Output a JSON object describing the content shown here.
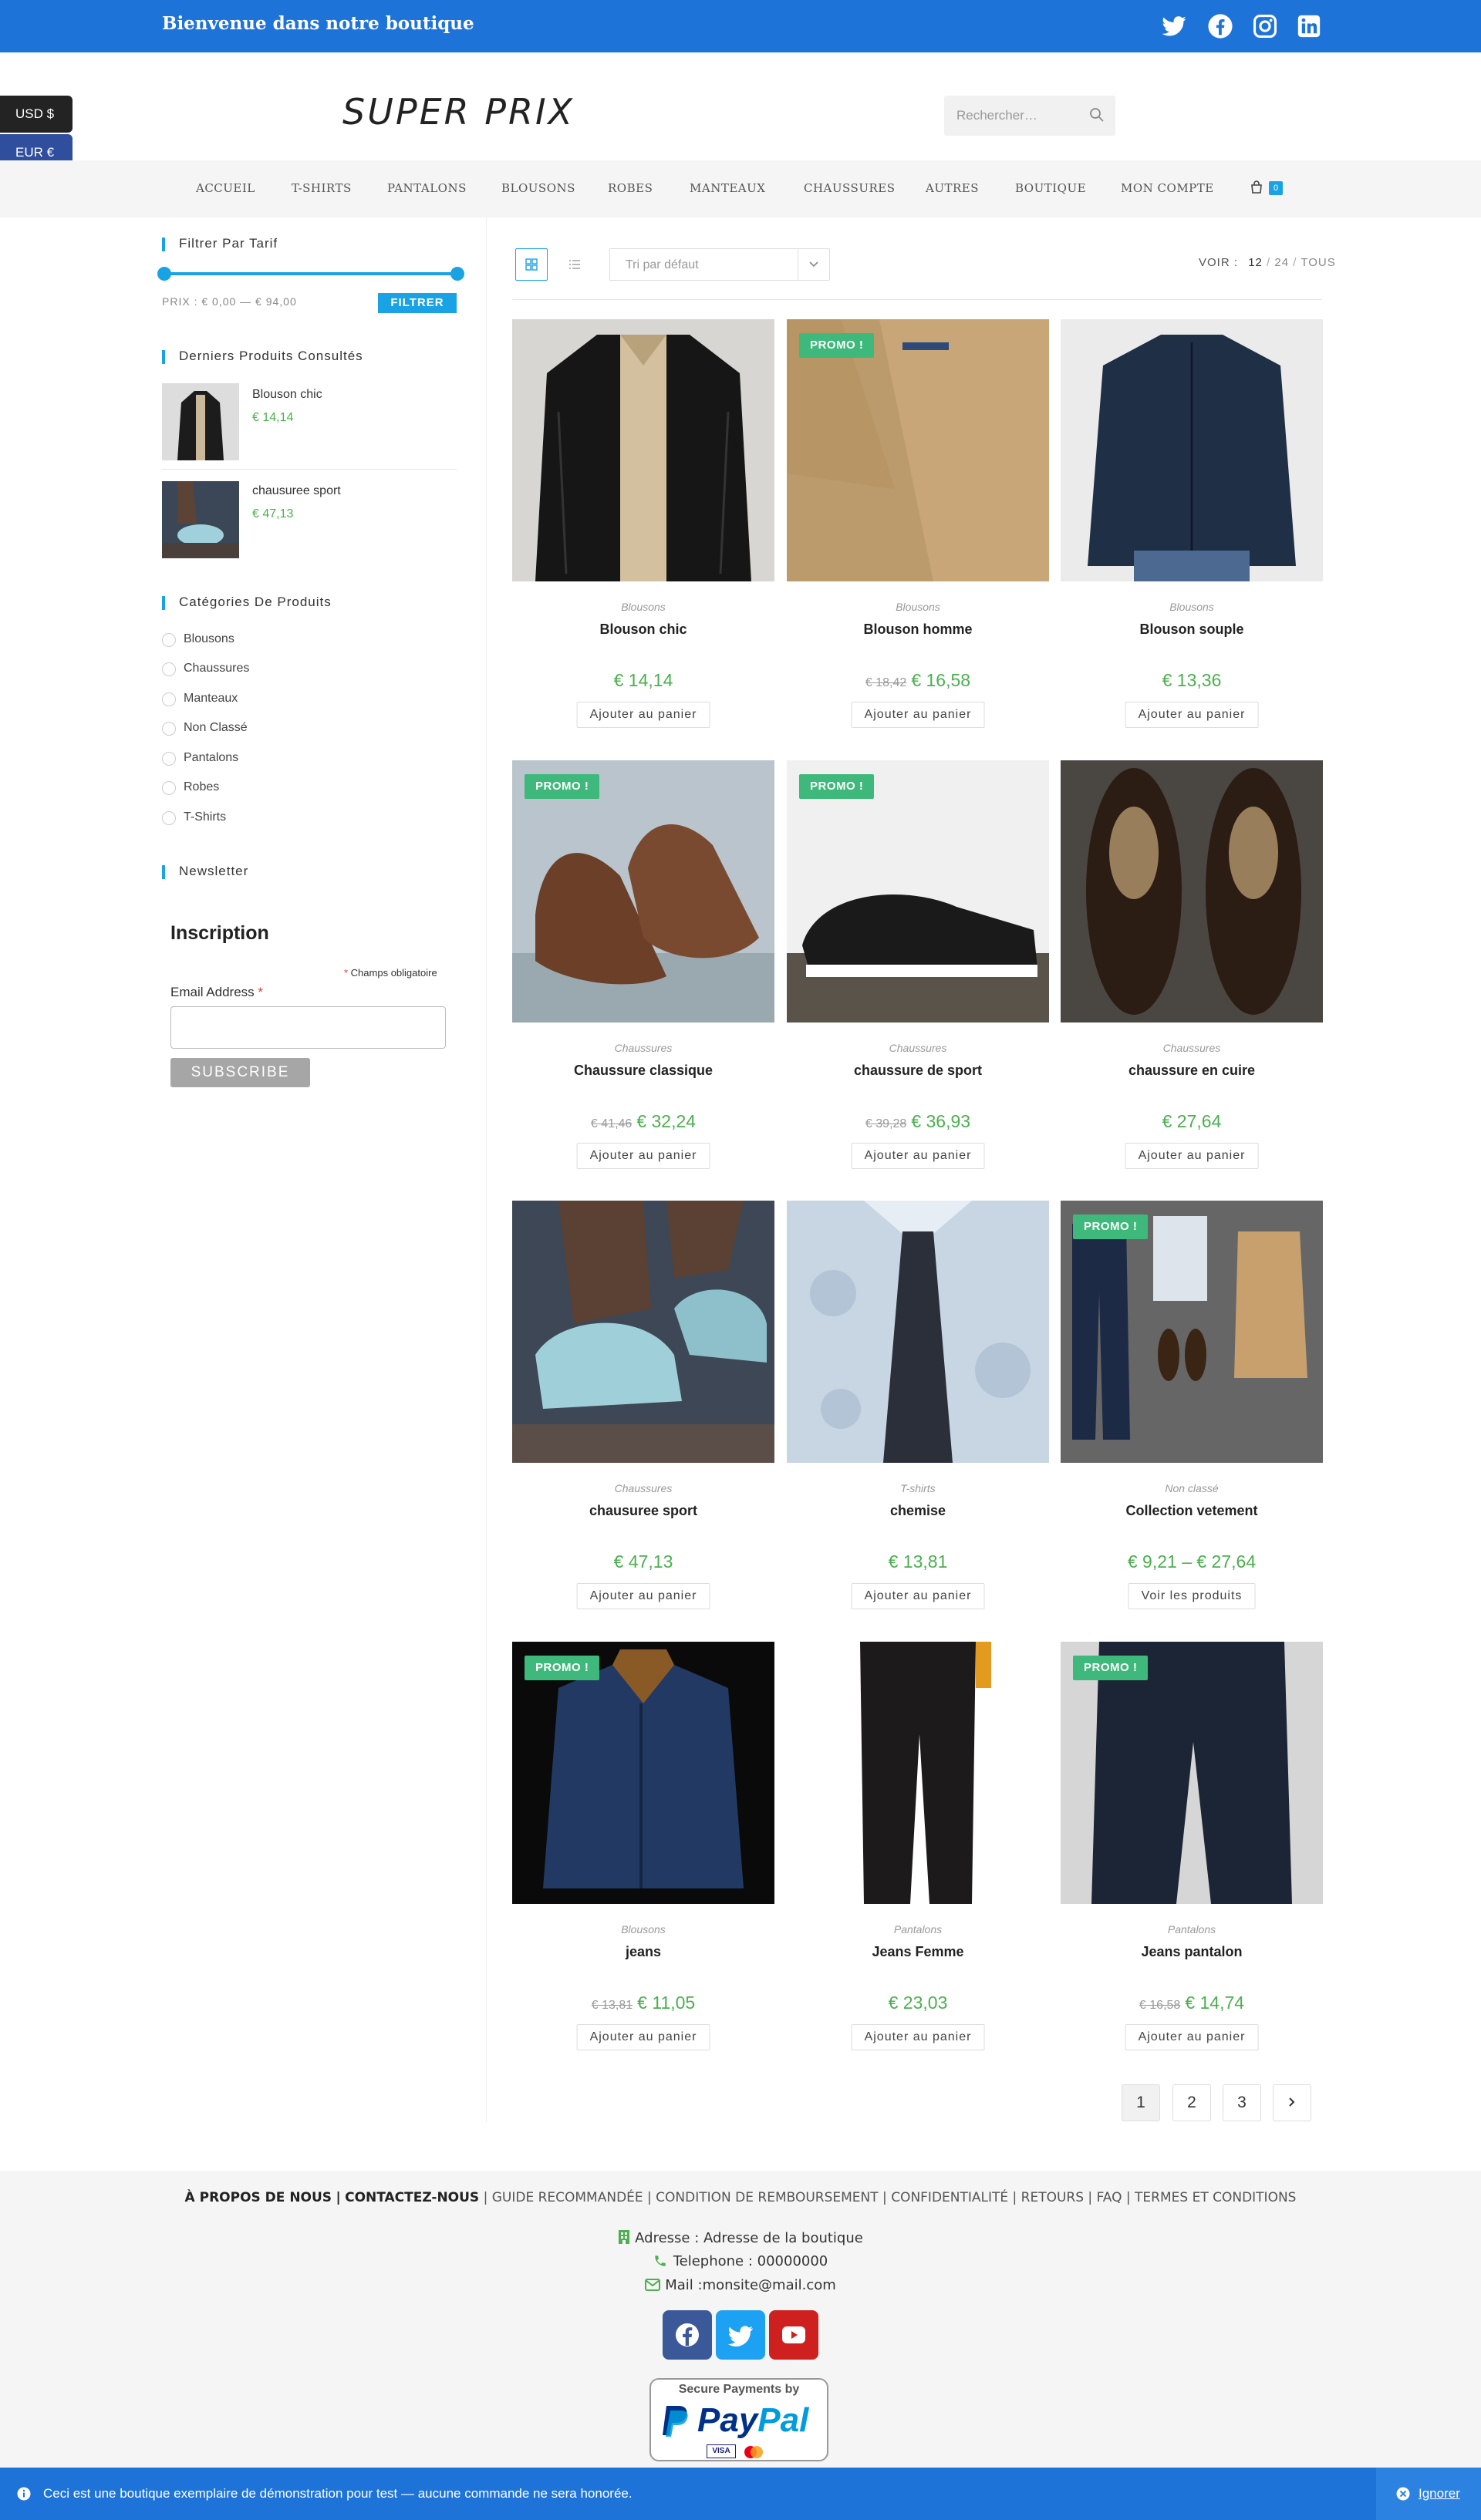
{
  "header": {
    "welcome": "Bienvenue dans notre boutique",
    "social_icons": [
      "twitter-icon",
      "facebook-icon",
      "instagram-icon",
      "linkedin-icon"
    ]
  },
  "currency": {
    "usd": "USD $",
    "eur": "EUR €"
  },
  "logo": "SUPER PRIX",
  "search": {
    "placeholder": "Rechercher…"
  },
  "nav": {
    "items": [
      "ACCUEIL",
      "T-SHIRTS",
      "PANTALONS",
      "BLOUSONS",
      "ROBES",
      "MANTEAUX",
      "CHAUSSURES",
      "AUTRES",
      "BOUTIQUE",
      "MON COMPTE"
    ],
    "cart_count": "0"
  },
  "sidebar": {
    "filter_title": "Filtrer Par Tarif",
    "price_range": "PRIX : € 0,00 — € 94,00",
    "filter_button": "FILTRER",
    "recent_title": "Derniers Produits Consultés",
    "recent": [
      {
        "name": "Blouson chic",
        "price": "€ 14,14"
      },
      {
        "name": "chausuree sport",
        "price": "€ 47,13"
      }
    ],
    "categories_title": "Catégories De Produits",
    "categories": [
      "Blousons",
      "Chaussures",
      "Manteaux",
      "Non Classé",
      "Pantalons",
      "Robes",
      "T-Shirts"
    ],
    "newsletter_title": "Newsletter",
    "inscription": "Inscription",
    "required_note": "Champs obligatoire",
    "email_label": "Email Address",
    "subscribe": "SUBSCRIBE"
  },
  "toolbar": {
    "sort_label": "Tri par défaut",
    "voir_label": "VOIR :",
    "voir_12": "12",
    "voir_24": "24",
    "voir_tous": "TOUS",
    "sep": "/"
  },
  "promo_label": "PROMO !",
  "products": [
    {
      "category": "Blousons",
      "name": "Blouson chic",
      "old_price": "",
      "price": "€ 14,14",
      "button": "Ajouter au panier",
      "promo": false
    },
    {
      "category": "Blousons",
      "name": "Blouson homme",
      "old_price": "€ 18,42",
      "price": "€ 16,58",
      "button": "Ajouter au panier",
      "promo": true
    },
    {
      "category": "Blousons",
      "name": "Blouson souple",
      "old_price": "",
      "price": "€ 13,36",
      "button": "Ajouter au panier",
      "promo": false
    },
    {
      "category": "Chaussures",
      "name": "Chaussure classique",
      "old_price": "€ 41,46",
      "price": "€ 32,24",
      "button": "Ajouter au panier",
      "promo": true
    },
    {
      "category": "Chaussures",
      "name": "chaussure de sport",
      "old_price": "€ 39,28",
      "price": "€ 36,93",
      "button": "Ajouter au panier",
      "promo": true
    },
    {
      "category": "Chaussures",
      "name": "chaussure en cuire",
      "old_price": "",
      "price": "€ 27,64",
      "button": "Ajouter au panier",
      "promo": false
    },
    {
      "category": "Chaussures",
      "name": "chausuree sport",
      "old_price": "",
      "price": "€ 47,13",
      "button": "Ajouter au panier",
      "promo": false
    },
    {
      "category": "T-shirts",
      "name": "chemise",
      "old_price": "",
      "price": "€ 13,81",
      "button": "Ajouter au panier",
      "promo": false
    },
    {
      "category": "Non classé",
      "name": "Collection vetement",
      "old_price": "",
      "price": "€ 9,21 – € 27,64",
      "button": "Voir les produits",
      "promo": true
    },
    {
      "category": "Blousons",
      "name": "jeans",
      "old_price": "€ 13,81",
      "price": "€ 11,05",
      "button": "Ajouter au panier",
      "promo": true
    },
    {
      "category": "Pantalons",
      "name": "Jeans Femme",
      "old_price": "",
      "price": "€ 23,03",
      "button": "Ajouter au panier",
      "promo": false
    },
    {
      "category": "Pantalons",
      "name": "Jeans pantalon",
      "old_price": "€ 16,58",
      "price": "€ 14,74",
      "button": "Ajouter au panier",
      "promo": true
    }
  ],
  "pagination": [
    "1",
    "2",
    "3"
  ],
  "footer": {
    "link_about": "À PROPOS DE NOUS",
    "link_contact": "CONTACTEZ-NOUS",
    "links_rest": "| GUIDE RECOMMANDÉE | CONDITION DE REMBOURSEMENT | CONFIDENTIALITÉ | RETOURS | FAQ | TERMES ET CONDITIONS",
    "address": "Adresse : Adresse de la boutique",
    "phone": "Telephone : 00000000",
    "mail": "Mail :monsite@mail.com",
    "paypal_top": "Secure Payments by",
    "paypal_pay": "Pay",
    "paypal_pal": "Pal",
    "visa": "VISA"
  },
  "cookie": {
    "text": "Ceci est une boutique exemplaire de démonstration pour test — aucune commande ne sera honorée.",
    "ignore": "Ignorer"
  }
}
